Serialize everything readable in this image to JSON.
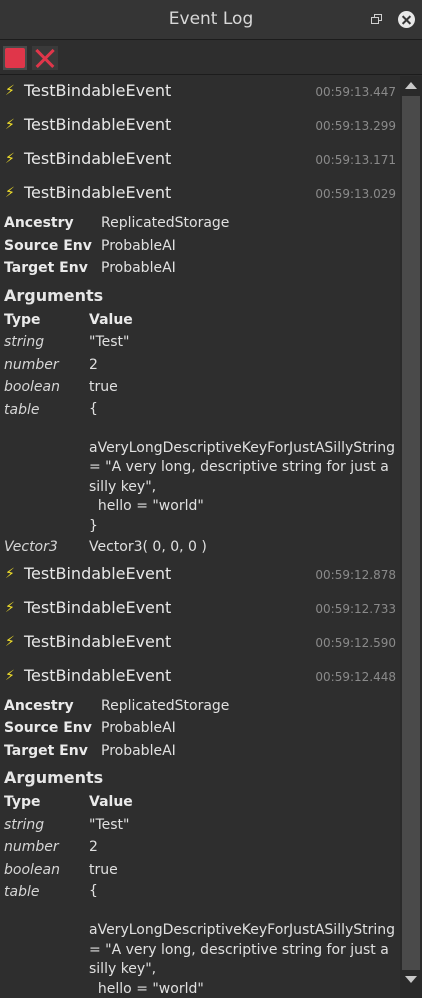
{
  "window": {
    "title": "Event Log"
  },
  "toolbar": {
    "stop_label": "Stop",
    "clear_label": "Clear"
  },
  "groups": [
    {
      "events": [
        {
          "name": "TestBindableEvent",
          "time": "00:59:13.447"
        },
        {
          "name": "TestBindableEvent",
          "time": "00:59:13.299"
        },
        {
          "name": "TestBindableEvent",
          "time": "00:59:13.171"
        },
        {
          "name": "TestBindableEvent",
          "time": "00:59:13.029"
        }
      ],
      "meta": [
        {
          "key": "Ancestry",
          "value": "ReplicatedStorage"
        },
        {
          "key": "Source Env",
          "value": "ProbableAI"
        },
        {
          "key": "Target Env",
          "value": "ProbableAI"
        }
      ],
      "arguments_label": "Arguments",
      "args_header": {
        "type": "Type",
        "value": "Value"
      },
      "args": [
        {
          "type": "string",
          "value": "\"Test\""
        },
        {
          "type": "number",
          "value": "2"
        },
        {
          "type": "boolean",
          "value": "true"
        },
        {
          "type": "table",
          "value": "{\n\naVeryLongDescriptiveKeyForJustASillyString = \"A very long, descriptive string for just a silly key\",\n  hello = \"world\"\n}"
        },
        {
          "type": "Vector3",
          "value": "Vector3( 0, 0, 0 )"
        }
      ]
    },
    {
      "events": [
        {
          "name": "TestBindableEvent",
          "time": "00:59:12.878"
        },
        {
          "name": "TestBindableEvent",
          "time": "00:59:12.733"
        },
        {
          "name": "TestBindableEvent",
          "time": "00:59:12.590"
        },
        {
          "name": "TestBindableEvent",
          "time": "00:59:12.448"
        }
      ],
      "meta": [
        {
          "key": "Ancestry",
          "value": "ReplicatedStorage"
        },
        {
          "key": "Source Env",
          "value": "ProbableAI"
        },
        {
          "key": "Target Env",
          "value": "ProbableAI"
        }
      ],
      "arguments_label": "Arguments",
      "args_header": {
        "type": "Type",
        "value": "Value"
      },
      "args": [
        {
          "type": "string",
          "value": "\"Test\""
        },
        {
          "type": "number",
          "value": "2"
        },
        {
          "type": "boolean",
          "value": "true"
        },
        {
          "type": "table",
          "value": "{\n\naVeryLongDescriptiveKeyForJustASillyString = \"A very long, descriptive string for just a silly key\",\n  hello = \"world\"\n}"
        }
      ]
    }
  ],
  "colors": {
    "accent_red": "#e0364a",
    "bolt_yellow": "#f2e02a",
    "timestamp": "#8a8a8a"
  },
  "icons": [
    "restore-icon",
    "close-icon",
    "stop-icon",
    "clear-icon",
    "lightning-icon"
  ]
}
